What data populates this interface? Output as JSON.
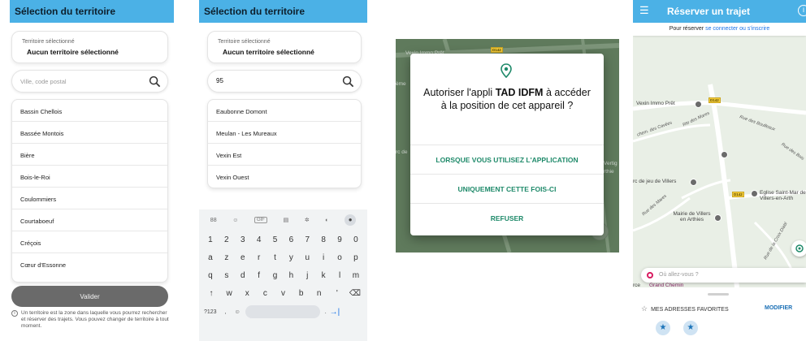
{
  "screen1": {
    "title": "Sélection du territoire",
    "selected_label": "Territoire sélectionné",
    "selected_value": "Aucun territoire sélectionné",
    "search_placeholder": "Ville, code postal",
    "items": [
      "Bassin Chellois",
      "Bassée Montois",
      "Bière",
      "Bois-le-Roi",
      "Coulommiers",
      "Courtaboeuf",
      "Créçois",
      "Cœur d'Essonne"
    ],
    "validate_label": "Valider",
    "info_icon": "i",
    "info_text": "Un territoire est la zone dans laquelle vous pourrez rechercher et réserver des trajets. Vous pouvez changer de territoire à tout moment."
  },
  "screen2": {
    "title": "Sélection du territoire",
    "selected_label": "Territoire sélectionné",
    "selected_value": "Aucun territoire sélectionné",
    "search_value": "95",
    "results": [
      "Eaubonne Domont",
      "Meulan - Les Mureaux",
      "Vexin Est",
      "Vexin Ouest"
    ],
    "keyboard": {
      "toolbar": [
        "88",
        "☺",
        "GIF",
        "▤",
        "✲",
        "◐",
        "🎤"
      ],
      "numbers": [
        "1",
        "2",
        "3",
        "4",
        "5",
        "6",
        "7",
        "8",
        "9",
        "0"
      ],
      "row1": [
        "a",
        "z",
        "e",
        "r",
        "t",
        "y",
        "u",
        "i",
        "o",
        "p"
      ],
      "row2": [
        "q",
        "s",
        "d",
        "f",
        "g",
        "h",
        "j",
        "k",
        "l",
        "m"
      ],
      "row3": [
        "↑",
        "w",
        "x",
        "c",
        "v",
        "b",
        "n",
        "'",
        "⌫"
      ],
      "sym_key": "?123",
      "comma_key": ",",
      "emoji_key": "☺",
      "period_key": ".",
      "enter_key": "→|"
    }
  },
  "screen3": {
    "question_pre": "Autoriser l'appli ",
    "question_app": "TAD IDFM",
    "question_post": " à accéder à la position de cet appareil ?",
    "option_while_using": "LORSQUE VOUS UTILISEZ L'APPLICATION",
    "option_once": "UNIQUEMENT CETTE FOIS-CI",
    "option_refuse": "REFUSER",
    "map_label_top": "Vexin Immo Prêt",
    "map_label_left": "ème",
    "map_label_left2": "rc de",
    "map_label_right": "rthie",
    "map_label_right2": "Vertig",
    "road_badge": "D142"
  },
  "screen4": {
    "title": "Réserver un trajet",
    "menu_icon": "☰",
    "info_icon": "i",
    "login_prefix": "Pour réserver ",
    "login_link": "se connecter ou s'inscrire",
    "map_labels": {
      "vexin": "Vexin Immo Prêt",
      "chemin_cavees": "chem. des Cavées",
      "rue_mares": "Rte des Mares",
      "rue_boulleaux": "Rue des Boulleaux",
      "rue_bois": "Rue des Bois",
      "parc": "rc de jeu de Villers",
      "rue_mares2": "Rue des Mares",
      "mairie": "Mairie de Villers en Arthies",
      "eglise": "Eglise Saint-Mar de Villers-en-Arth",
      "croix": "Rue de la Croix Diabl",
      "grand_chemin": "Grand Chemin",
      "rce": "rce",
      "badge1": "D142",
      "badge2": "D142"
    },
    "where_placeholder": "Où allez-vous ?",
    "favorites_label": "MES ADRESSES FAVORITES",
    "modify_label": "MODIFIER",
    "fav_star": "★"
  },
  "colors": {
    "header_blue": "#4bb1e6",
    "accent_green": "#1f8a6a",
    "button_gray": "#6a6a6a",
    "map_dark": "#5f7a5c",
    "link_blue": "#1a73e8",
    "pin_pink": "#d81b60"
  }
}
